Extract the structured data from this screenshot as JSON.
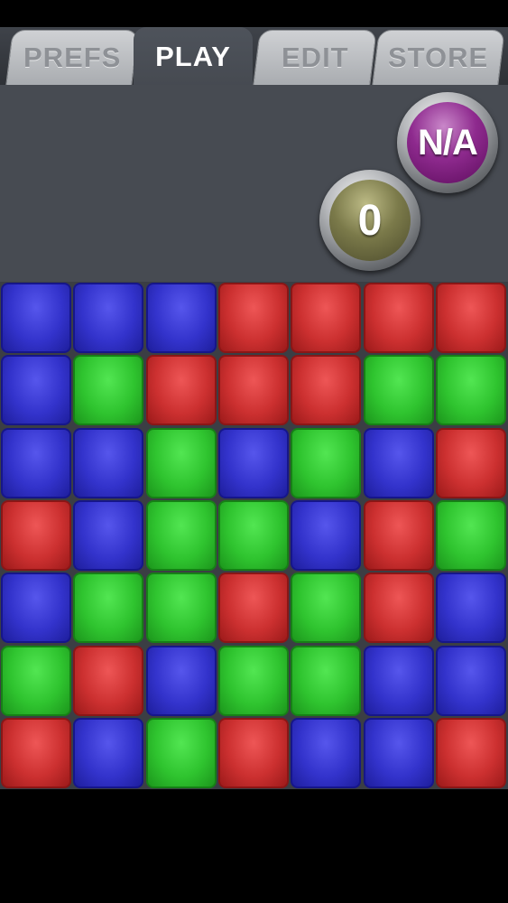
{
  "tabs": [
    {
      "id": "prefs",
      "label": "PREFS",
      "active": false
    },
    {
      "id": "play",
      "label": "PLAY",
      "active": true
    },
    {
      "id": "edit",
      "label": "EDIT",
      "active": false
    },
    {
      "id": "store",
      "label": "STORE",
      "active": false
    }
  ],
  "scoreboard": {
    "best_label": "N/A",
    "score_label": "0"
  },
  "colors": {
    "blue": "#3333cc",
    "red": "#cc3030",
    "green": "#2fc42f",
    "best_badge": "#8e2a8e",
    "score_badge": "#7b7a4a"
  },
  "board": {
    "rows": 7,
    "cols": 7,
    "grid": [
      [
        "blue",
        "blue",
        "blue",
        "red",
        "red",
        "red",
        "red"
      ],
      [
        "blue",
        "green",
        "red",
        "red",
        "red",
        "green",
        "green"
      ],
      [
        "blue",
        "blue",
        "green",
        "blue",
        "green",
        "blue",
        "red"
      ],
      [
        "red",
        "blue",
        "green",
        "green",
        "blue",
        "red",
        "green"
      ],
      [
        "blue",
        "green",
        "green",
        "red",
        "green",
        "red",
        "blue"
      ],
      [
        "green",
        "red",
        "blue",
        "green",
        "green",
        "blue",
        "blue"
      ],
      [
        "red",
        "blue",
        "green",
        "red",
        "blue",
        "blue",
        "red"
      ]
    ]
  }
}
